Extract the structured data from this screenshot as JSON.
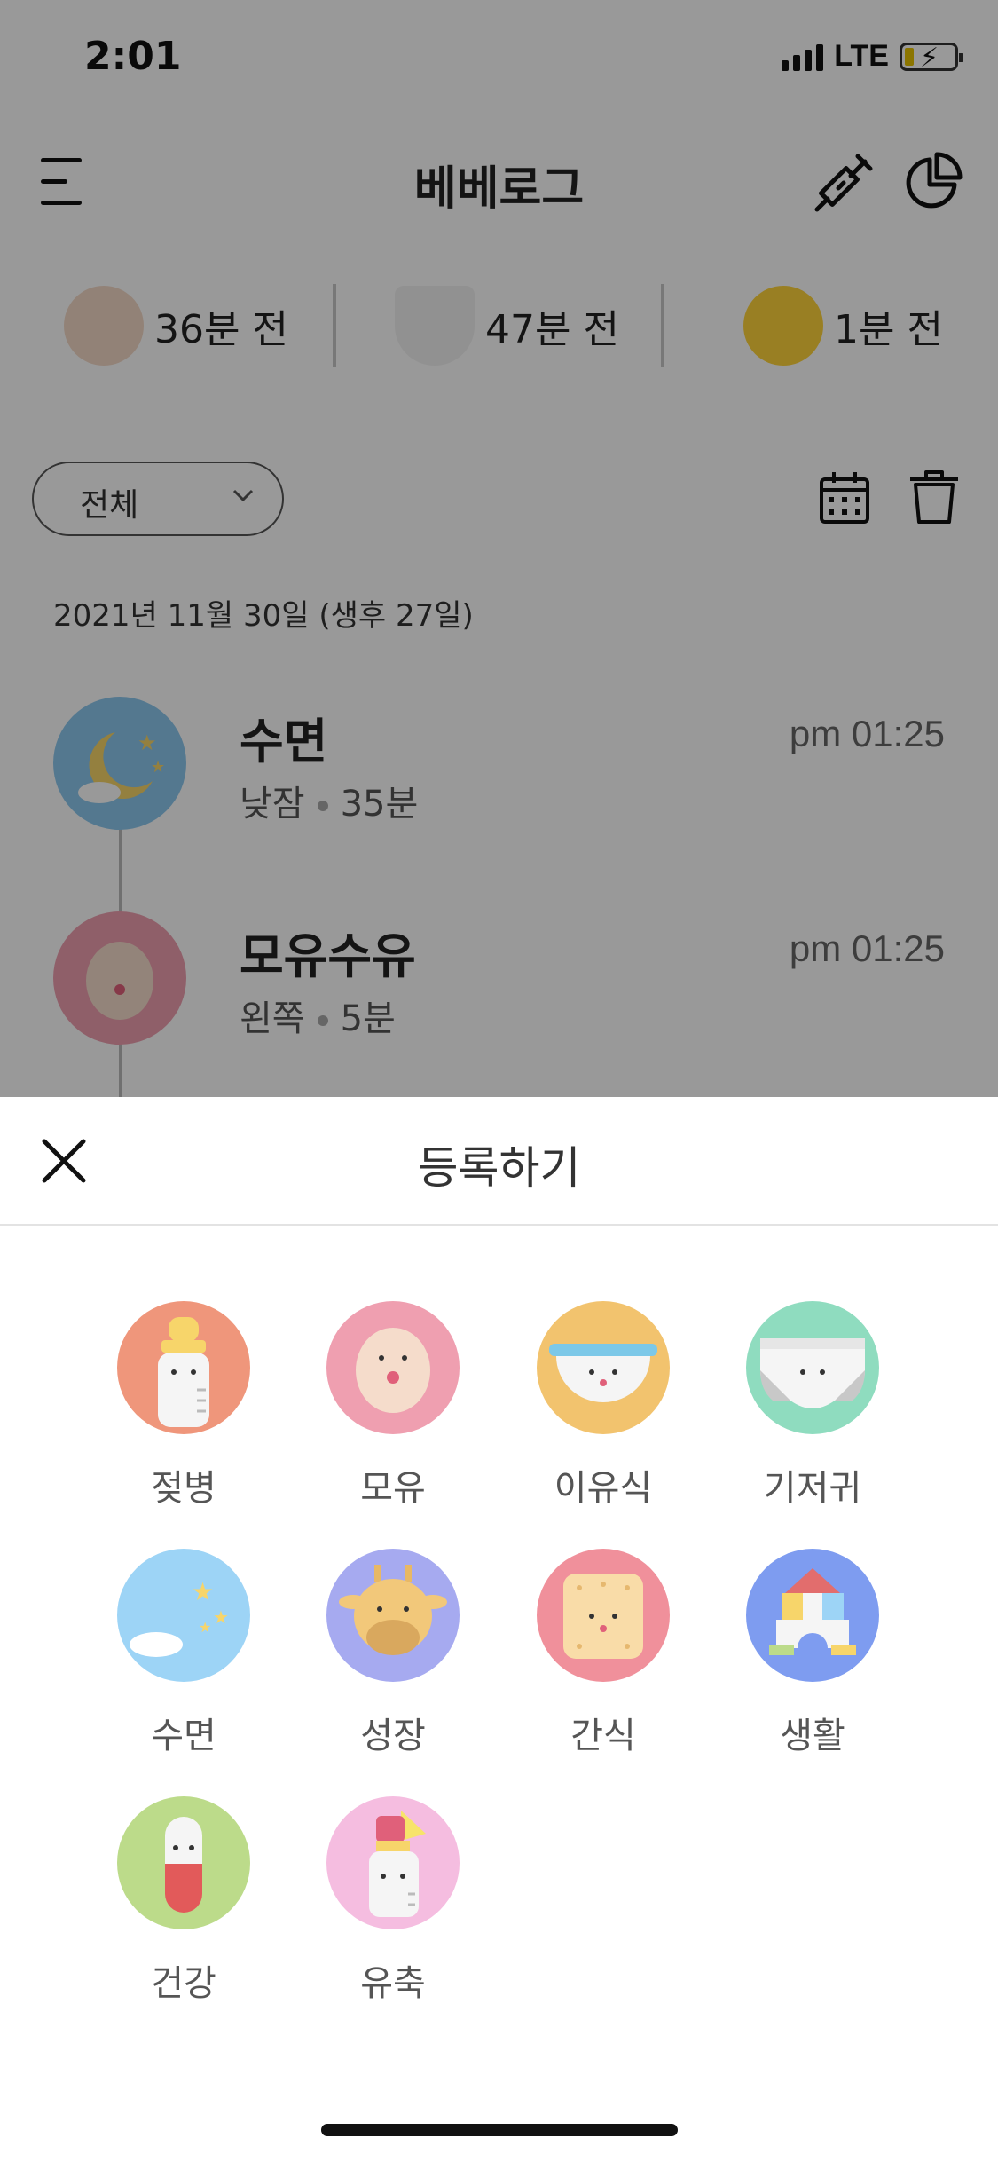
{
  "status_bar": {
    "time": "2:01",
    "network": "LTE"
  },
  "app_bar": {
    "title": "베베로그",
    "icons": [
      "menu-icon",
      "syringe-icon",
      "pie-chart-icon"
    ]
  },
  "summary": [
    {
      "icon": "breast-icon",
      "text": "36분 전"
    },
    {
      "icon": "diaper-icon",
      "text": "47분 전"
    },
    {
      "icon": "sun-icon",
      "text": "1분 전"
    }
  ],
  "filter": {
    "selected": "전체",
    "icons": [
      "calendar-icon",
      "trash-icon"
    ]
  },
  "date_label": "2021년 11월 30일 (생후 27일)",
  "logs": [
    {
      "title": "수면",
      "detail_type": "낮잠",
      "detail_value": "35분",
      "time": "pm 01:25",
      "icon": "sleep-icon"
    },
    {
      "title": "모유수유",
      "detail_type": "왼쪽",
      "detail_value": "5분",
      "time": "pm 01:25",
      "icon": "breastfeed-icon"
    }
  ],
  "sheet": {
    "title": "등록하기",
    "items": [
      {
        "label": "젖병",
        "color": "#ef967b",
        "icon": "bottle-icon"
      },
      {
        "label": "모유",
        "color": "#ef9fb0",
        "icon": "breast-icon"
      },
      {
        "label": "이유식",
        "color": "#f2c36e",
        "icon": "bowl-icon"
      },
      {
        "label": "기저귀",
        "color": "#8fdcbf",
        "icon": "diaper-icon"
      },
      {
        "label": "수면",
        "color": "#9dd4f6",
        "icon": "moon-icon"
      },
      {
        "label": "성장",
        "color": "#a6aaf0",
        "icon": "giraffe-icon"
      },
      {
        "label": "간식",
        "color": "#f0909b",
        "icon": "cookie-icon"
      },
      {
        "label": "생활",
        "color": "#7e9cf0",
        "icon": "blocks-icon"
      },
      {
        "label": "건강",
        "color": "#bcdb8a",
        "icon": "pill-icon"
      },
      {
        "label": "유축",
        "color": "#f5bde0",
        "icon": "pump-icon"
      }
    ]
  }
}
